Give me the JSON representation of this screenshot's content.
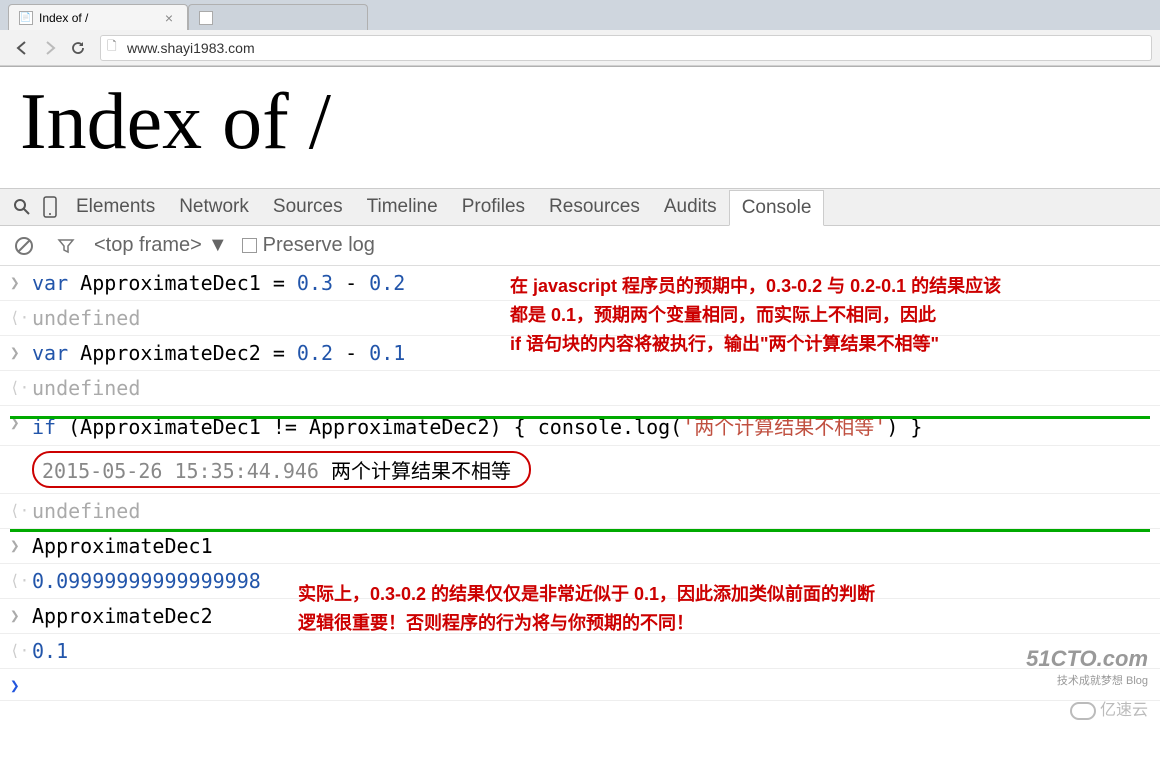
{
  "browser": {
    "tabs": [
      {
        "title": "Index of /",
        "active": true
      },
      {
        "title": "",
        "active": false
      }
    ],
    "url": "www.shayi1983.com"
  },
  "page": {
    "title": "Index of /"
  },
  "devtools": {
    "tabs": [
      "Elements",
      "Network",
      "Sources",
      "Timeline",
      "Profiles",
      "Resources",
      "Audits",
      "Console"
    ],
    "active_tab": "Console",
    "frame_selector": "<top frame>",
    "preserve_log_label": "Preserve log"
  },
  "console": {
    "lines": [
      {
        "type": "input",
        "segments": [
          {
            "t": "kw",
            "v": "var"
          },
          {
            "t": "plain",
            "v": " ApproximateDec1 = "
          },
          {
            "t": "num",
            "v": "0.3"
          },
          {
            "t": "plain",
            "v": " - "
          },
          {
            "t": "num",
            "v": "0.2"
          }
        ]
      },
      {
        "type": "output",
        "segments": [
          {
            "t": "undef",
            "v": "undefined"
          }
        ]
      },
      {
        "type": "input",
        "segments": [
          {
            "t": "kw",
            "v": "var"
          },
          {
            "t": "plain",
            "v": " ApproximateDec2 = "
          },
          {
            "t": "num",
            "v": "0.2"
          },
          {
            "t": "plain",
            "v": " - "
          },
          {
            "t": "num",
            "v": "0.1"
          }
        ]
      },
      {
        "type": "output",
        "segments": [
          {
            "t": "undef",
            "v": "undefined"
          }
        ]
      },
      {
        "type": "input",
        "segments": [
          {
            "t": "kw",
            "v": "if"
          },
          {
            "t": "plain",
            "v": " (ApproximateDec1 != ApproximateDec2) { console.log("
          },
          {
            "t": "str",
            "v": "'两个计算结果不相等'"
          },
          {
            "t": "plain",
            "v": ") }"
          }
        ]
      },
      {
        "type": "log",
        "boxed": true,
        "segments": [
          {
            "t": "log-time",
            "v": "2015-05-26 15:35:44.946 "
          },
          {
            "t": "plain",
            "v": " 两个计算结果不相等"
          }
        ]
      },
      {
        "type": "output",
        "segments": [
          {
            "t": "undef",
            "v": "undefined"
          }
        ]
      },
      {
        "type": "input",
        "segments": [
          {
            "t": "plain",
            "v": "ApproximateDec1"
          }
        ]
      },
      {
        "type": "result",
        "segments": [
          {
            "t": "num",
            "v": "0.09999999999999998"
          }
        ]
      },
      {
        "type": "input",
        "segments": [
          {
            "t": "plain",
            "v": "ApproximateDec2"
          }
        ]
      },
      {
        "type": "result",
        "segments": [
          {
            "t": "num",
            "v": "0.1"
          }
        ]
      },
      {
        "type": "prompt",
        "segments": []
      }
    ]
  },
  "annotations": {
    "a1_l1": "在 javascript 程序员的预期中，0.3-0.2 与 0.2-0.1 的结果应该",
    "a1_l2": "都是 0.1，预期两个变量相同，而实际上不相同，因此",
    "a1_l3": " if 语句块的内容将被执行，输出\"两个计算结果不相等\"",
    "a2_l1": "实际上，0.3-0.2 的结果仅仅是非常近似于 0.1，因此添加类似前面的判断",
    "a2_l2": "逻辑很重要！否则程序的行为将与你预期的不同！"
  },
  "watermark": {
    "line1": "51CTO.com",
    "line2": "技术成就梦想   Blog",
    "bottom": "亿速云"
  }
}
